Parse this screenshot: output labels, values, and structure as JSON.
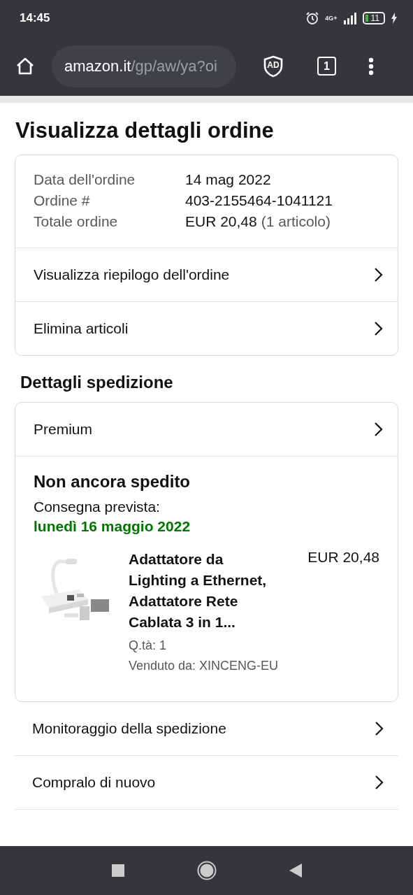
{
  "status_bar": {
    "time": "14:45",
    "network": "4G+",
    "battery": "11"
  },
  "browser": {
    "url_host": "amazon.it",
    "url_path": "/gp/aw/ya?oi",
    "tab_count": "1",
    "adblock_label": "AD"
  },
  "title": "Visualizza dettagli ordine",
  "order_summary": {
    "fields": [
      {
        "label": "Data dell'ordine",
        "value": "14 mag 2022"
      },
      {
        "label": "Ordine #",
        "value": "403-2155464-1041121"
      },
      {
        "label": "Totale ordine",
        "value": "EUR 20,48",
        "note": "(1 articolo)"
      }
    ],
    "links": [
      "Visualizza riepilogo dell'ordine",
      "Elimina articoli"
    ]
  },
  "shipping": {
    "heading": "Dettagli spedizione",
    "service": "Premium",
    "status": "Non ancora spedito",
    "delivery_label": "Consegna prevista:",
    "delivery_date": "lunedì 16 maggio 2022",
    "item": {
      "kind": "picture",
      "name": "Adattatore da Lighting a Ethernet, Adattatore Rete Cablata 3 in 1...",
      "price": "EUR 20,48",
      "quantity": "Q.tà: 1",
      "seller": "Venduto da: XINCENG-EU"
    }
  },
  "actions": [
    "Monitoraggio della spedizione",
    "Compralo di nuovo"
  ]
}
